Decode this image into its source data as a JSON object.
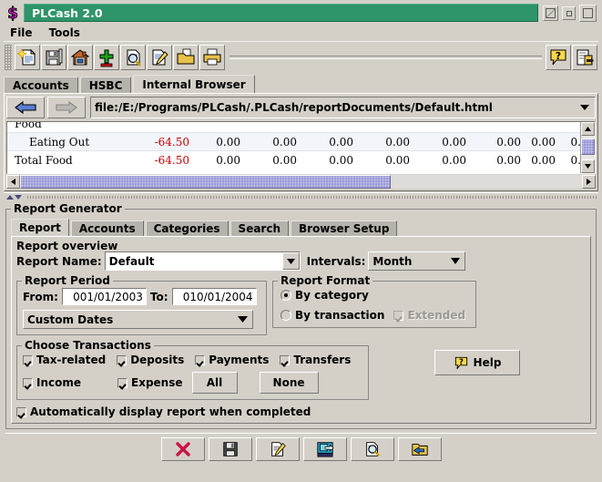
{
  "window": {
    "title": "PLCash 2.0",
    "app_icon": "dollar-sign-icon",
    "controls": [
      {
        "name": "minimize-button",
        "glyph": "minimize"
      },
      {
        "name": "restore-button",
        "glyph": "restore"
      },
      {
        "name": "maximize-button",
        "glyph": "maximize"
      }
    ]
  },
  "menubar": {
    "items": [
      {
        "label": "File",
        "name": "menu-file"
      },
      {
        "label": "Tools",
        "name": "menu-tools"
      }
    ]
  },
  "toolbar": {
    "buttons": [
      {
        "name": "new-file-button",
        "icon": "new-document-icon"
      },
      {
        "name": "save-file-button",
        "icon": "floppy-disk-icon"
      },
      {
        "name": "home-button",
        "icon": "house-icon"
      },
      {
        "name": "add-remove-button",
        "icon": "plus-minus-icon"
      },
      {
        "name": "find-button",
        "icon": "magnifier-document-icon"
      },
      {
        "name": "edit-button",
        "icon": "pencil-document-icon"
      },
      {
        "name": "open-folder-button",
        "icon": "open-folder-icon"
      },
      {
        "name": "print-button",
        "icon": "printer-icon"
      }
    ],
    "right_buttons": [
      {
        "name": "help-button",
        "icon": "question-balloon-icon"
      },
      {
        "name": "report-button",
        "icon": "report-window-icon"
      }
    ]
  },
  "main_tabs": {
    "items": [
      {
        "label": "Accounts",
        "name": "tab-accounts",
        "selected": false
      },
      {
        "label": "HSBC",
        "name": "tab-hsbc",
        "selected": false
      },
      {
        "label": "Internal Browser",
        "name": "tab-internal-browser",
        "selected": true
      }
    ]
  },
  "browser": {
    "back_icon": "back-arrow-icon",
    "forward_icon": "forward-arrow-icon",
    "url": "file:/E:/Programs/PLCash/.PLCash/reportDocuments/Default.html",
    "rows": [
      {
        "label": "Food",
        "values": [],
        "clipped": "top"
      },
      {
        "label": "Eating Out",
        "values": [
          "-64.50",
          "0.00",
          "0.00",
          "0.00",
          "0.00",
          "0.00",
          "0.00",
          "0.00",
          "0."
        ]
      },
      {
        "label": "Total Food",
        "values": [
          "-64.50",
          "0.00",
          "0.00",
          "0.00",
          "0.00",
          "0.00",
          "0.00",
          "0.00",
          "0."
        ],
        "clipped": "bottom"
      }
    ],
    "scroll_up_icon": "scroll-up-arrow-icon",
    "scroll_down_icon": "scroll-down-arrow-icon",
    "scroll_left_icon": "scroll-left-arrow-icon",
    "scroll_right_icon": "scroll-right-arrow-icon"
  },
  "report_generator": {
    "legend": "Report Generator",
    "tabs": [
      {
        "label": "Report",
        "name": "tab-report",
        "selected": true
      },
      {
        "label": "Accounts",
        "name": "tab-accounts-inner",
        "selected": false
      },
      {
        "label": "Categories",
        "name": "tab-categories",
        "selected": false
      },
      {
        "label": "Search",
        "name": "tab-search",
        "selected": false
      },
      {
        "label": "Browser Setup",
        "name": "tab-browser-setup",
        "selected": false
      }
    ],
    "overview": {
      "legend": "Report overview",
      "report_name_label": "Report Name:",
      "report_name_value": "Default",
      "intervals_label": "Intervals:",
      "intervals_value": "Month"
    },
    "period": {
      "legend": "Report Period",
      "from_label": "From:",
      "from_value": "001/01/2003",
      "to_label": "To:",
      "to_value": "010/01/2004",
      "preset_value": "Custom Dates"
    },
    "format": {
      "legend": "Report Format",
      "by_category_label": "By category",
      "by_category_selected": true,
      "by_transaction_label": "By transaction",
      "by_transaction_selected": false,
      "extended_label": "Extended",
      "extended_checked": true,
      "extended_disabled": true
    },
    "transactions": {
      "legend": "Choose Transactions",
      "checks": [
        {
          "label": "Tax-related",
          "name": "checkbox-tax-related",
          "checked": true
        },
        {
          "label": "Deposits",
          "name": "checkbox-deposits",
          "checked": true
        },
        {
          "label": "Payments",
          "name": "checkbox-payments",
          "checked": true
        },
        {
          "label": "Transfers",
          "name": "checkbox-transfers",
          "checked": true
        },
        {
          "label": "Income",
          "name": "checkbox-income",
          "checked": true
        },
        {
          "label": "Expense",
          "name": "checkbox-expense",
          "checked": true
        }
      ],
      "all_label": "All",
      "none_label": "None"
    },
    "auto_display": {
      "label": "Automatically display report when completed",
      "checked": true
    },
    "help_label": "Help",
    "help_icon": "question-balloon-icon"
  },
  "action_bar": {
    "buttons": [
      {
        "name": "delete-button",
        "icon": "red-x-icon"
      },
      {
        "name": "save-button",
        "icon": "floppy-disk-icon"
      },
      {
        "name": "edit-button",
        "icon": "pencil-document-icon"
      },
      {
        "name": "generate-report-button",
        "icon": "report-window-icon"
      },
      {
        "name": "preview-button",
        "icon": "magnifier-document-icon"
      },
      {
        "name": "open-button",
        "icon": "folder-back-arrow-icon"
      }
    ]
  },
  "colors": {
    "titlebar": "#2e9469",
    "face": "#d4d0c8",
    "negative": "#cc0000",
    "scrollbar_thumb": "#9a99d6"
  }
}
